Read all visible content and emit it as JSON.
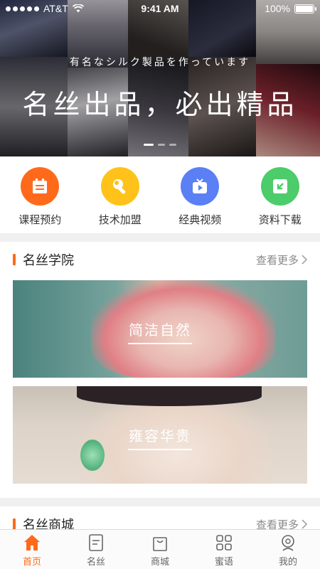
{
  "status_bar": {
    "carrier": "AT&T",
    "time": "9:41 AM",
    "battery": "100%",
    "battery_level": 1.0
  },
  "hero": {
    "subtitle": "有名なシルク製品を作っています",
    "title": "名丝出品，必出精品",
    "pager": {
      "count": 3,
      "active_index": 0
    }
  },
  "quick_menu": [
    {
      "label": "课程预约",
      "icon": "calendar-icon",
      "color": "#ff6a1a"
    },
    {
      "label": "技术加盟",
      "icon": "wrench-icon",
      "color": "#ffc21a"
    },
    {
      "label": "经典视频",
      "icon": "tv-play-icon",
      "color": "#5b7ff5"
    },
    {
      "label": "资料下载",
      "icon": "download-icon",
      "color": "#4ccc6a"
    }
  ],
  "academy": {
    "title": "名丝学院",
    "more": "查看更多",
    "banners": [
      {
        "text": "简洁自然"
      },
      {
        "text": "雍容华贵"
      }
    ]
  },
  "mall": {
    "title": "名丝商城",
    "more": "查看更多"
  },
  "tabbar": {
    "items": [
      {
        "label": "首页",
        "icon": "home-icon",
        "active": true
      },
      {
        "label": "名丝",
        "icon": "document-icon",
        "active": false
      },
      {
        "label": "商城",
        "icon": "shopping-bag-icon",
        "active": false
      },
      {
        "label": "蜜语",
        "icon": "grid-icon",
        "active": false
      },
      {
        "label": "我的",
        "icon": "user-icon",
        "active": false
      }
    ]
  },
  "colors": {
    "accent": "#ff6a1a",
    "inactive_tab": "#666666",
    "separator": "#f0f0f0"
  }
}
